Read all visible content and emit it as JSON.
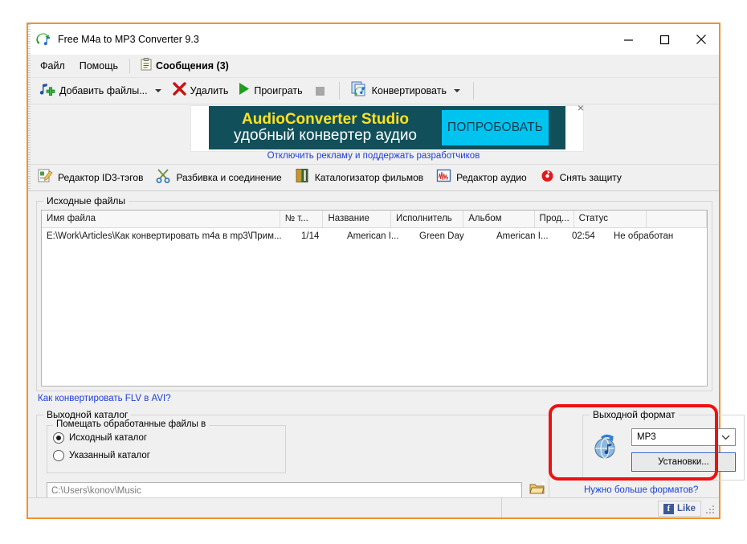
{
  "window": {
    "title": "Free M4a to MP3 Converter 9.3",
    "app_icon": "converter-app-icon",
    "minimize_label": "Свернуть",
    "maximize_label": "Развернуть",
    "close_label": "Закрыть"
  },
  "menubar": {
    "items": [
      {
        "label": "Файл",
        "name": "menu-file"
      },
      {
        "label": "Помощь",
        "name": "menu-help"
      }
    ],
    "messages_tab": {
      "label": "Сообщения (3)",
      "icon": "clipboard-icon"
    }
  },
  "toolbar": {
    "add_files": {
      "label": "Добавить файлы...",
      "accel": "Д",
      "icon": "add-music-file-icon"
    },
    "remove": {
      "label": "Удалить",
      "accel": "У",
      "icon": "red-cross-icon"
    },
    "play": {
      "label": "Проиграть",
      "accel": "П",
      "icon": "play-triangle-icon"
    },
    "stop": {
      "label": "Стоп",
      "icon": "stop-square-icon"
    },
    "convert": {
      "label": "Конвертировать",
      "accel": "К",
      "icon": "convert-icon"
    }
  },
  "ad": {
    "line1": "AudioConverter Studio",
    "line2": "удобный конвертер аудио",
    "button": "ПОПРОБОВАТЬ",
    "close": "×",
    "subtitle": "Отключить рекламу и поддержать разработчиков",
    "bg_color": "#11505b",
    "title_color": "#ffe21f",
    "button_color": "#00c3f0"
  },
  "toolbar2": {
    "items": [
      {
        "label": "Редактор ID3-тэгов",
        "icon": "id3-tag-editor-icon",
        "name": "tool-id3-editor"
      },
      {
        "label": "Разбивка и соединение",
        "icon": "scissors-icon",
        "name": "tool-split-join"
      },
      {
        "label": "Каталогизатор фильмов",
        "icon": "film-catalog-icon",
        "name": "tool-movie-catalog"
      },
      {
        "label": "Редактор аудио",
        "icon": "waveform-icon",
        "name": "tool-audio-editor"
      },
      {
        "label": "Снять защиту",
        "icon": "broken-disc-icon",
        "name": "tool-remove-protection"
      }
    ]
  },
  "source_files": {
    "group_label": "Исходные файлы",
    "columns": [
      "Имя файла",
      "№ т...",
      "Название",
      "Исполнитель",
      "Альбом",
      "Прод...",
      "Статус",
      ""
    ],
    "rows": [
      {
        "filename": "E:\\Work\\Articles\\Как конвертировать m4a в mp3\\Прим...",
        "track": "1/14",
        "title": "American I...",
        "artist": "Green Day",
        "album": "American I...",
        "duration": "02:54",
        "status": "Не обработан",
        "extra": ""
      }
    ]
  },
  "links": {
    "flv_to_avi": "Как конвертировать FLV в AVI?",
    "more_formats": "Нужно больше форматов?"
  },
  "output_dir": {
    "group_label": "Выходной каталог",
    "inner_label": "Помещать обработанные файлы в",
    "options": [
      {
        "label": "Исходный каталог",
        "selected": true
      },
      {
        "label": "Указанный каталог",
        "selected": false
      }
    ],
    "path_value": "C:\\Users\\konov\\Music",
    "browse_icon": "folder-open-icon"
  },
  "output_format": {
    "group_label": "Выходной формат",
    "icon": "format-globe-note-icon",
    "selected_format": "MP3",
    "settings_button": "Установки...",
    "highlight_color": "#ee1111",
    "focus_border_color": "#2d62c4"
  },
  "statusbar": {
    "facebook_like": "Like",
    "facebook_icon": "facebook-f-icon"
  }
}
